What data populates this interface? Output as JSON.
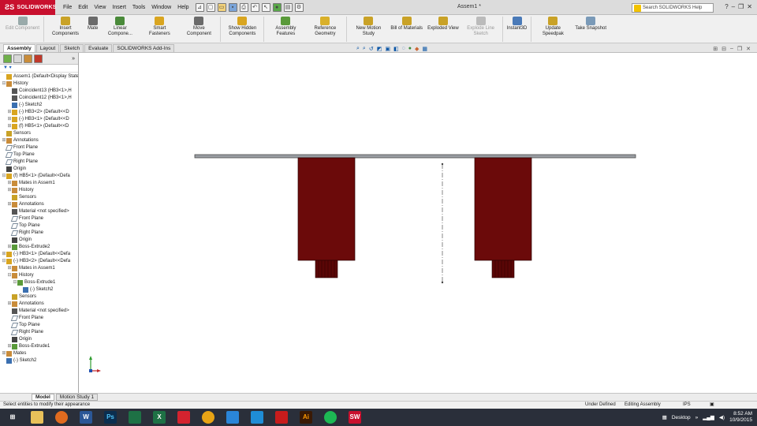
{
  "titlebar": {
    "brand": "SOLIDWORKS",
    "menus": [
      "File",
      "Edit",
      "View",
      "Insert",
      "Tools",
      "Window",
      "Help"
    ],
    "document_title": "Assem1 *",
    "help_search_placeholder": "Search SOLIDWORKS Help"
  },
  "ribbon": {
    "buttons": [
      {
        "label": "Edit Component",
        "icon": "edit-component-icon",
        "disabled": true
      },
      {
        "label": "Insert Components",
        "icon": "insert-components-icon"
      },
      {
        "label": "Mate",
        "icon": "mate-icon"
      },
      {
        "label": "Linear Compone...",
        "icon": "linear-pattern-icon"
      },
      {
        "label": "Smart Fasteners",
        "icon": "smart-fasteners-icon"
      },
      {
        "label": "Move Component",
        "icon": "move-component-icon"
      },
      {
        "label": "Show Hidden Components",
        "icon": "show-hidden-icon"
      },
      {
        "label": "Assembly Features",
        "icon": "assembly-features-icon"
      },
      {
        "label": "Reference Geometry",
        "icon": "reference-geometry-icon"
      },
      {
        "label": "New Motion Study",
        "icon": "motion-study-icon"
      },
      {
        "label": "Bill of Materials",
        "icon": "bom-icon"
      },
      {
        "label": "Exploded View",
        "icon": "exploded-view-icon"
      },
      {
        "label": "Explode Line Sketch",
        "icon": "explode-line-icon",
        "disabled": true
      },
      {
        "label": "Instant3D",
        "icon": "instant3d-icon"
      },
      {
        "label": "Update Speedpak",
        "icon": "speedpak-icon"
      },
      {
        "label": "Take Snapshot",
        "icon": "snapshot-icon"
      }
    ]
  },
  "tabs": [
    "Assembly",
    "Layout",
    "Sketch",
    "Evaluate",
    "SOLIDWORKS Add-Ins"
  ],
  "active_tab": "Assembly",
  "tree": [
    {
      "indent": 0,
      "icon": "assembly-icon",
      "label": "Assem1  (Default<Display State"
    },
    {
      "indent": 0,
      "icon": "history-icon",
      "label": "History",
      "exp": "-"
    },
    {
      "indent": 1,
      "icon": "mate-icon",
      "label": "Coincident13 (HB3<1>,H"
    },
    {
      "indent": 1,
      "icon": "mate-icon",
      "label": "Coincident12 (HB3<1>,H"
    },
    {
      "indent": 1,
      "icon": "sketch-icon",
      "label": "(-) Sketch2"
    },
    {
      "indent": 1,
      "icon": "part-icon",
      "label": "(-) HB3<2> (Default<<D",
      "exp": "+"
    },
    {
      "indent": 1,
      "icon": "part-icon",
      "label": "(-) HB3<1> (Default<<D",
      "exp": "+"
    },
    {
      "indent": 1,
      "icon": "part-icon",
      "label": "(f) HB5<1> (Default<<D",
      "exp": "+"
    },
    {
      "indent": 0,
      "icon": "sensors-icon",
      "label": "Sensors"
    },
    {
      "indent": 0,
      "icon": "annotations-icon",
      "label": "Annotations",
      "exp": "+"
    },
    {
      "indent": 0,
      "icon": "plane-icon",
      "label": "Front Plane"
    },
    {
      "indent": 0,
      "icon": "plane-icon",
      "label": "Top Plane"
    },
    {
      "indent": 0,
      "icon": "plane-icon",
      "label": "Right Plane"
    },
    {
      "indent": 0,
      "icon": "origin-icon",
      "label": "Origin"
    },
    {
      "indent": 0,
      "icon": "part-icon",
      "label": "(f) HB5<1> (Default<<Defa",
      "exp": "-"
    },
    {
      "indent": 1,
      "icon": "mates-folder-icon",
      "label": "Mates in Assem1",
      "exp": "+"
    },
    {
      "indent": 1,
      "icon": "history-icon",
      "label": "History",
      "exp": "+"
    },
    {
      "indent": 1,
      "icon": "sensors-icon",
      "label": "Sensors"
    },
    {
      "indent": 1,
      "icon": "annotations-icon",
      "label": "Annotations",
      "exp": "+"
    },
    {
      "indent": 1,
      "icon": "material-icon",
      "label": "Material <not specified>"
    },
    {
      "indent": 1,
      "icon": "plane-icon",
      "label": "Front Plane"
    },
    {
      "indent": 1,
      "icon": "plane-icon",
      "label": "Top Plane"
    },
    {
      "indent": 1,
      "icon": "plane-icon",
      "label": "Right Plane"
    },
    {
      "indent": 1,
      "icon": "origin-icon",
      "label": "Origin"
    },
    {
      "indent": 1,
      "icon": "feature-icon",
      "label": "Boss-Extrude2",
      "exp": "+"
    },
    {
      "indent": 0,
      "icon": "part-icon",
      "label": "(-) HB3<1> (Default<<Defa",
      "exp": "+"
    },
    {
      "indent": 0,
      "icon": "part-icon",
      "label": "(-) HB3<2> (Default<<Defa",
      "exp": "-"
    },
    {
      "indent": 1,
      "icon": "mates-folder-icon",
      "label": "Mates in Assem1",
      "exp": "+"
    },
    {
      "indent": 1,
      "icon": "history-icon",
      "label": "History",
      "exp": "-"
    },
    {
      "indent": 2,
      "icon": "feature-icon",
      "label": "Boss-Extrude1",
      "exp": "-"
    },
    {
      "indent": 3,
      "icon": "sketch-icon",
      "label": "(-) Sketch2"
    },
    {
      "indent": 1,
      "icon": "sensors-icon",
      "label": "Sensors"
    },
    {
      "indent": 1,
      "icon": "annotations-icon",
      "label": "Annotations",
      "exp": "+"
    },
    {
      "indent": 1,
      "icon": "material-icon",
      "label": "Material <not specified>"
    },
    {
      "indent": 1,
      "icon": "plane-icon",
      "label": "Front Plane"
    },
    {
      "indent": 1,
      "icon": "plane-icon",
      "label": "Top Plane"
    },
    {
      "indent": 1,
      "icon": "plane-icon",
      "label": "Right Plane"
    },
    {
      "indent": 1,
      "icon": "origin-icon",
      "label": "Origin"
    },
    {
      "indent": 1,
      "icon": "feature-icon",
      "label": "Boss-Extrude1",
      "exp": "+"
    },
    {
      "indent": 0,
      "icon": "mates-folder-icon",
      "label": "Mates",
      "exp": "+"
    },
    {
      "indent": 0,
      "icon": "sketch-icon",
      "label": "(-) Sketch2"
    }
  ],
  "bottom_tabs": [
    "Model",
    "Motion Study 1"
  ],
  "status": {
    "message": "Select entities to modify their appearance",
    "state": "Under Defined",
    "mode": "Editing Assembly",
    "units": "IPS"
  },
  "taskbar": {
    "desktop_label": "Desktop",
    "time": "8:52 AM",
    "date": "10/9/2015"
  },
  "colors": {
    "part_red": "#6b0a0a",
    "plate_gray": "#9a9ea3",
    "brand_red": "#c8102e",
    "taskbar": "#2a2f3a"
  }
}
